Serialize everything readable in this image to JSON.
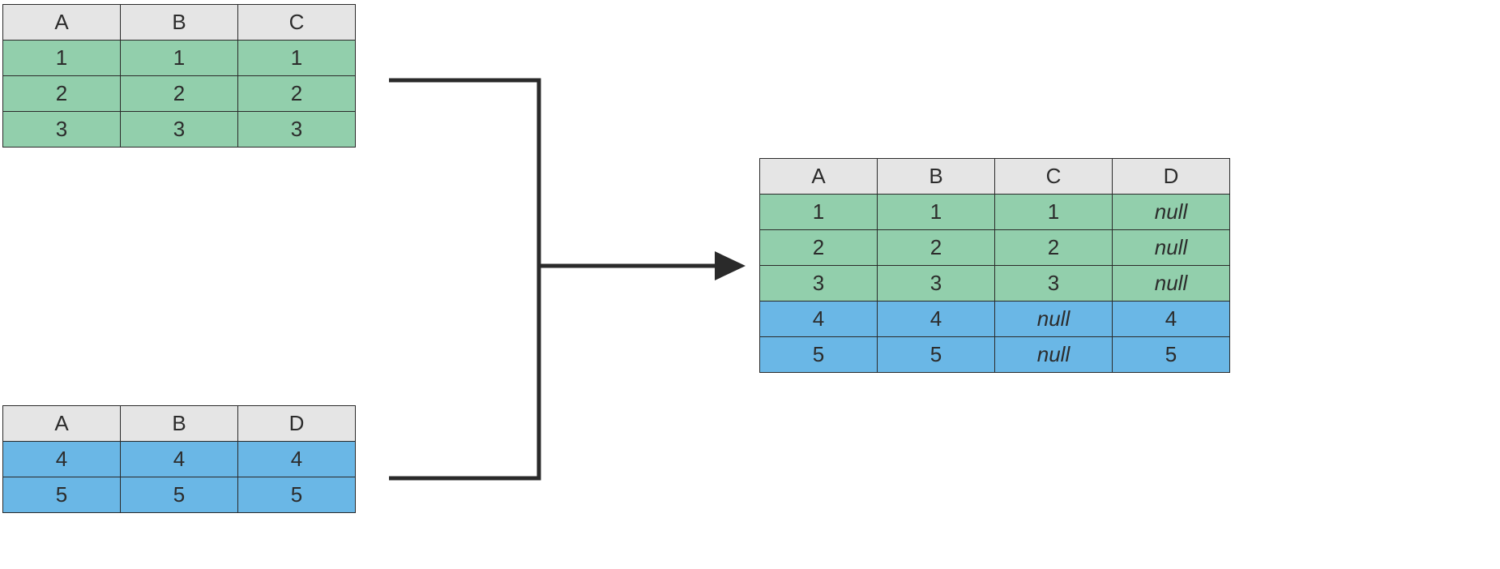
{
  "colors": {
    "header": "#e5e5e5",
    "green": "#92cfac",
    "blue": "#6ab7e6",
    "border": "#2a2a2a"
  },
  "top_table": {
    "headers": [
      "A",
      "B",
      "C"
    ],
    "rows": [
      [
        "1",
        "1",
        "1"
      ],
      [
        "2",
        "2",
        "2"
      ],
      [
        "3",
        "3",
        "3"
      ]
    ]
  },
  "bottom_table": {
    "headers": [
      "A",
      "B",
      "D"
    ],
    "rows": [
      [
        "4",
        "4",
        "4"
      ],
      [
        "5",
        "5",
        "5"
      ]
    ]
  },
  "result_table": {
    "headers": [
      "A",
      "B",
      "C",
      "D"
    ],
    "rows": [
      {
        "values": [
          "1",
          "1",
          "1",
          "null"
        ],
        "color": "green",
        "italic_cols": [
          3
        ]
      },
      {
        "values": [
          "2",
          "2",
          "2",
          "null"
        ],
        "color": "green",
        "italic_cols": [
          3
        ]
      },
      {
        "values": [
          "3",
          "3",
          "3",
          "null"
        ],
        "color": "green",
        "italic_cols": [
          3
        ]
      },
      {
        "values": [
          "4",
          "4",
          "null",
          "4"
        ],
        "color": "blue",
        "italic_cols": [
          2
        ]
      },
      {
        "values": [
          "5",
          "5",
          "null",
          "5"
        ],
        "color": "blue",
        "italic_cols": [
          2
        ]
      }
    ]
  }
}
